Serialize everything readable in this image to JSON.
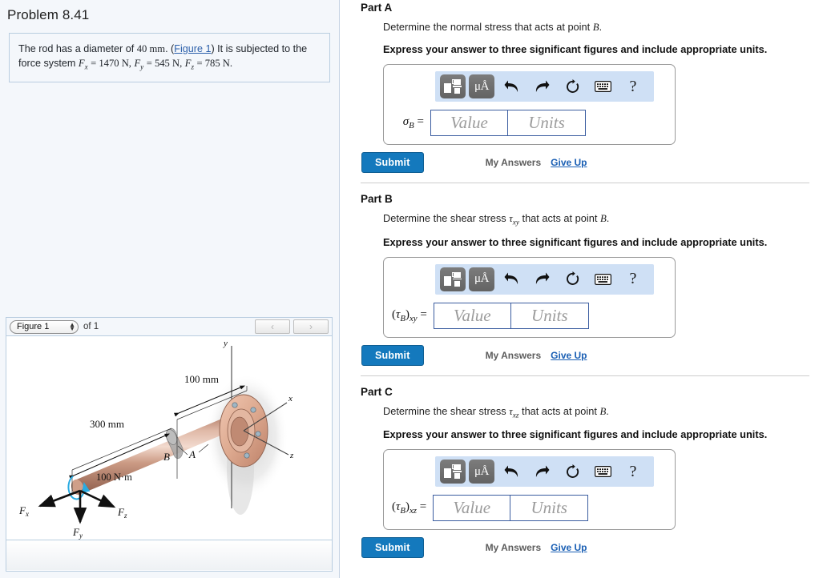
{
  "problem": {
    "title": "Problem 8.41",
    "statement_pre": "The rod has a diameter of ",
    "diameter_value": "40",
    "diameter_unit": "mm",
    "statement_link": "Figure 1",
    "statement_mid": "It is subjected to the force system ",
    "fx_label": "F",
    "fx_sub": "x",
    "fx_value": "= 1470 N,",
    "fy_label": "F",
    "fy_sub": "y",
    "fy_value": "= 545 N,",
    "fz_label": "F",
    "fz_sub": "z",
    "fz_value": "= 785 N."
  },
  "figure_widget": {
    "select_value": "Figure 1",
    "of_label": "of 1",
    "prev_icon": "chevron-left-icon",
    "next_icon": "chevron-right-icon"
  },
  "figure": {
    "title": "Rod fixed to wall flange with applied force system",
    "axis_labels": {
      "x": "x",
      "y": "y",
      "z": "z"
    },
    "dim_100": "100 mm",
    "dim_300": "300 mm",
    "point_a": "A",
    "point_b": "B",
    "torque": "100 N·m",
    "force_x": "F",
    "force_x_sub": "x",
    "force_y": "F",
    "force_y_sub": "y",
    "force_z": "F",
    "force_z_sub": "z",
    "colors": {
      "rod_light": "#e8c8b8",
      "rod_mid": "#c99782",
      "rod_dark": "#9d6a57",
      "flange": "#e0b5a0",
      "wall_shadow": "#d9d9d9",
      "torque_arrow": "#29abe2"
    }
  },
  "toolbar": {
    "math_icon": "math-template-icon",
    "units_icon": "greek-units-icon",
    "units_text": "μÅ",
    "undo_icon": "undo-icon",
    "redo_icon": "redo-icon",
    "reset_icon": "reset-icon",
    "keyboard_icon": "keyboard-icon",
    "help_icon": "help-icon",
    "help_text": "?"
  },
  "common": {
    "express_note": "Express your answer to three significant figures and include appropriate units.",
    "value_placeholder": "Value",
    "units_placeholder": "Units",
    "submit_label": "Submit",
    "my_answers_label": "My Answers",
    "give_up_label": "Give Up"
  },
  "parts": [
    {
      "heading": "Part A",
      "question_pre": "Determine the normal stress that acts at point ",
      "question_sym": "",
      "question_sym_sub": "",
      "question_mid": "",
      "question_point": "B",
      "question_post": ".",
      "answer_symbol": "σ",
      "answer_sub": "B",
      "answer_sub2": "",
      "answer_paren": false,
      "equals": "="
    },
    {
      "heading": "Part B",
      "question_pre": "Determine the shear stress ",
      "question_sym": "τ",
      "question_sym_sub": "xy",
      "question_mid": " that acts at point ",
      "question_point": "B",
      "question_post": ".",
      "answer_symbol": "τ",
      "answer_sub": "B",
      "answer_sub2": "xy",
      "answer_paren": true,
      "equals": "="
    },
    {
      "heading": "Part C",
      "question_pre": "Determine the shear stress ",
      "question_sym": "τ",
      "question_sym_sub": "xz",
      "question_mid": " that acts at point ",
      "question_point": "B",
      "question_post": ".",
      "answer_symbol": "τ",
      "answer_sub": "B",
      "answer_sub2": "xz",
      "answer_paren": true,
      "equals": "="
    }
  ]
}
